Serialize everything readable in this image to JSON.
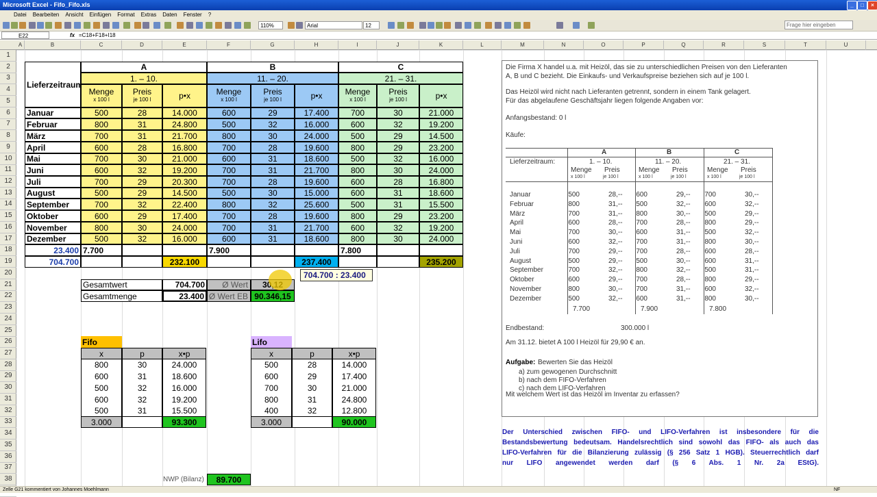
{
  "window": {
    "title": "Microsoft Excel - Fifo_Fifo.xls"
  },
  "menu": [
    "Datei",
    "Bearbeiten",
    "Ansicht",
    "Einfügen",
    "Format",
    "Extras",
    "Daten",
    "Fenster",
    "?"
  ],
  "toolbar": {
    "zoom": "110%",
    "font": "Arial",
    "size": "12",
    "help": "Frage hier eingeben"
  },
  "formula": {
    "namebox": "E22",
    "fx": "fx",
    "content": "=C18+F18+I18"
  },
  "columns": [
    "A",
    "B",
    "C",
    "D",
    "E",
    "F",
    "G",
    "H",
    "I",
    "J",
    "K",
    "L",
    "M",
    "N",
    "O",
    "P",
    "Q",
    "R",
    "S",
    "T",
    "U"
  ],
  "rows": [
    "1",
    "2",
    "3",
    "4",
    "5",
    "6",
    "7",
    "8",
    "9",
    "10",
    "11",
    "12",
    "13",
    "14",
    "15",
    "16",
    "17",
    "18",
    "19",
    "20",
    "21",
    "22",
    "23",
    "24",
    "25",
    "26",
    "27",
    "28",
    "29",
    "30",
    "31",
    "32",
    "33",
    "34",
    "35",
    "36",
    "37",
    "38",
    "39"
  ],
  "sheet": {
    "group_A": "A",
    "group_B": "B",
    "group_C": "C",
    "lieferzeitraum": "Lieferzeitraum:",
    "period_A": "1. – 10.",
    "period_B": "11. – 20.",
    "period_C": "21. – 31.",
    "menge": "Menge",
    "menge_unit": "x 100 l",
    "preis": "Preis",
    "preis_unit": "je 100 l",
    "px": "p•x",
    "months": [
      "Januar",
      "Februar",
      "März",
      "April",
      "Mai",
      "Juni",
      "Juli",
      "August",
      "September",
      "Oktober",
      "November",
      "Dezember"
    ],
    "a_menge": [
      "500",
      "800",
      "700",
      "600",
      "700",
      "600",
      "700",
      "500",
      "700",
      "600",
      "800",
      "500"
    ],
    "a_preis": [
      "28",
      "31",
      "31",
      "28",
      "30",
      "32",
      "29",
      "29",
      "32",
      "29",
      "30",
      "32"
    ],
    "a_px": [
      "14.000",
      "24.800",
      "21.700",
      "16.800",
      "21.000",
      "19.200",
      "20.300",
      "14.500",
      "22.400",
      "17.400",
      "24.000",
      "16.000"
    ],
    "b_menge": [
      "600",
      "500",
      "800",
      "700",
      "600",
      "700",
      "700",
      "500",
      "800",
      "700",
      "700",
      "600"
    ],
    "b_preis": [
      "29",
      "32",
      "30",
      "28",
      "31",
      "31",
      "28",
      "30",
      "32",
      "28",
      "31",
      "31"
    ],
    "b_px": [
      "17.400",
      "16.000",
      "24.000",
      "19.600",
      "18.600",
      "21.700",
      "19.600",
      "15.000",
      "25.600",
      "19.600",
      "21.700",
      "18.600"
    ],
    "c_menge": [
      "700",
      "600",
      "500",
      "800",
      "500",
      "800",
      "600",
      "600",
      "500",
      "800",
      "600",
      "800"
    ],
    "c_preis": [
      "30",
      "32",
      "29",
      "29",
      "32",
      "30",
      "28",
      "31",
      "31",
      "29",
      "32",
      "30"
    ],
    "c_px": [
      "21.000",
      "19.200",
      "14.500",
      "23.200",
      "16.000",
      "24.000",
      "16.800",
      "18.600",
      "15.500",
      "23.200",
      "19.200",
      "24.000"
    ],
    "sum_menge_total": "23.400",
    "sum_wert_total": "704.700",
    "sum_a_menge": "7.700",
    "sum_b_menge": "7.900",
    "sum_c_menge": "7.800",
    "sum_a_wert": "232.100",
    "sum_b_wert": "237.400",
    "sum_c_wert": "235.200",
    "gesamtwert_label": "Gesamtwert",
    "gesamtwert": "704.700",
    "gesamtmenge_label": "Gesamtmenge",
    "gesamtmenge": "23.400",
    "avg_label": "Ø Wert",
    "avg_value": "30,12",
    "avg_eb_label": "Ø Wert EB",
    "avg_eb_value": "90.346,15",
    "comment": "704.700 : 23.400",
    "fifo_title": "Fifo",
    "lifo_title": "Lifo",
    "x": "x",
    "p": "p",
    "xp": "x•p",
    "fifo_x": [
      "800",
      "600",
      "500",
      "600",
      "500"
    ],
    "fifo_p": [
      "30",
      "31",
      "32",
      "32",
      "31"
    ],
    "fifo_xp": [
      "24.000",
      "18.600",
      "16.000",
      "19.200",
      "15.500"
    ],
    "fifo_sum_x": "3.000",
    "fifo_sum_xp": "93.300",
    "lifo_x": [
      "500",
      "600",
      "700",
      "800",
      "400"
    ],
    "lifo_p": [
      "28",
      "29",
      "30",
      "31",
      "32"
    ],
    "lifo_xp": [
      "14.000",
      "17.400",
      "21.000",
      "24.800",
      "12.800"
    ],
    "lifo_sum_x": "3.000",
    "lifo_sum_xp": "90.000",
    "nwp_label": "NWP (Bilanz)",
    "nwp_value": "89.700"
  },
  "task": {
    "intro1": "Die Firma X handel u.a. mit Heizöl, das sie zu unterschiedlichen Preisen von den Lieferanten",
    "intro2": "A, B und C  bezieht. Die Einkaufs- und Verkaufspreise beziehen sich auf je 100 l.",
    "intro3": "Das Heizöl wird nicht nach Lieferanten getrennt, sondern in einem Tank gelagert.",
    "intro4": "Für das abgelaufene Geschäftsjahr liegen folgende Angaben vor:",
    "anfang": "Anfangsbestand:  0 l",
    "kaeufe": "Käufe:",
    "ta": "A",
    "tb": "B",
    "tc": "C",
    "lz": "Lieferzeitraum:",
    "p1": "1. – 10.",
    "p2": "11. – 20.",
    "p3": "21. – 31.",
    "m": "Menge",
    "mu": "x 100 l",
    "pr": "Preis",
    "pu": "je 100 l",
    "months": [
      "Januar",
      "Februar",
      "März",
      "April",
      "Mai",
      "Juni",
      "Juli",
      "August",
      "September",
      "Oktober",
      "November",
      "Dezember"
    ],
    "a_p": [
      "28,--",
      "31,--",
      "31,--",
      "28,--",
      "30,--",
      "32,--",
      "29,--",
      "29,--",
      "32,--",
      "29,--",
      "30,--",
      "32,--"
    ],
    "b_p": [
      "29,--",
      "32,--",
      "30,--",
      "28,--",
      "31,--",
      "31,--",
      "28,--",
      "30,--",
      "32,--",
      "28,--",
      "31,--",
      "31,--"
    ],
    "c_p": [
      "30,--",
      "32,--",
      "29,--",
      "29,--",
      "32,--",
      "30,--",
      "28,--",
      "31,--",
      "31,--",
      "29,--",
      "32,--",
      "30,--"
    ],
    "ta_sum": "7.700",
    "tb_sum": "7.900",
    "tc_sum": "7.800",
    "endbestand": "Endbestand:",
    "endbestand_val": "300.000 l",
    "angebot": "Am 31.12. bietet A 100 l Heizöl für 29,90 € an.",
    "aufgabe": "Aufgabe:",
    "aufgabe_text": " Bewerten Sie das Heizöl",
    "a": "a)   zum gewogenen Durchschnitt",
    "b": "b)   nach dem FIFO-Verfahren",
    "c": "c)   nach dem LIFO-Verfahren",
    "frage": "Mit welchem Wert ist das Heizöl im Inventar zu erfassen?"
  },
  "note": [
    "Der Unterschied zwischen FIFO- und LIFO-Verfahren ist insbesondere für die",
    "Bestandsbewertung bedeutsam. Handelsrechtlich sind sowohl das FIFO- als auch das",
    "LIFO-Verfahren für die Bilanzierung zulässig (§ 256 Satz 1 HGB). Steuerrechtlich darf",
    "nur  LIFO angewendet werden darf (§ 6 Abs. 1 Nr. 2a EStG)."
  ],
  "status": {
    "left": "Zelle G21 kommentiert von Johannes Moehlmann",
    "right": "NF"
  },
  "colors": {
    "yellow": "#fff38a",
    "blue": "#9cc9f5",
    "green": "#c9f0c9",
    "gold": "#f8d800",
    "cyan": "#00b0f0",
    "olive": "#a3a300",
    "bright_green": "#1fc41f",
    "gray": "#c0c0c0",
    "orange": "#ffc000",
    "lilac": "#d9b3ff",
    "note_blue": "#1a1ab0"
  }
}
